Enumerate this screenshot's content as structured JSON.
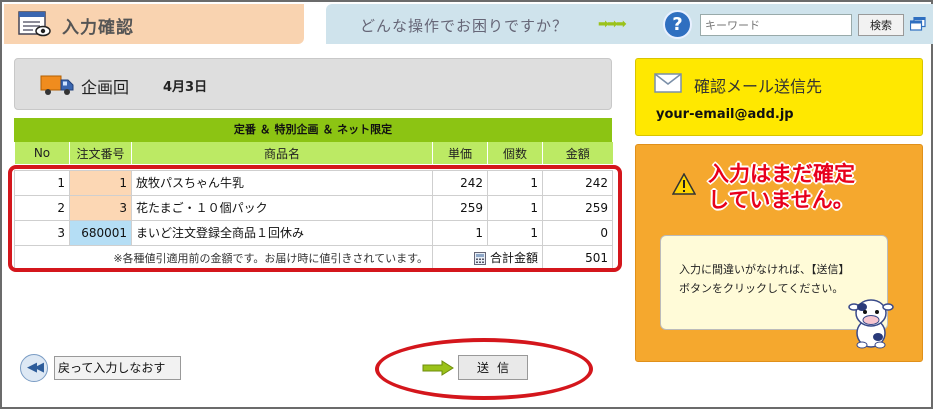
{
  "header": {
    "title": "入力確認",
    "question": "どんな操作でお困りですか？",
    "arrows": "➡➡➡",
    "help_label": "?",
    "search_placeholder": "キーワード",
    "search_button": "検索"
  },
  "plan": {
    "label": "企画回",
    "date": "4月3日"
  },
  "order": {
    "caption": "定番 ＆ 特別企画 ＆ ネット限定",
    "columns": [
      "No",
      "注文番号",
      "商品名",
      "単価",
      "個数",
      "金額"
    ],
    "rows": [
      {
        "no": "1",
        "order_no": "1",
        "name": "放牧パスちゃん牛乳",
        "price": "242",
        "qty": "1",
        "amount": "242"
      },
      {
        "no": "2",
        "order_no": "3",
        "name": "花たまご・１０個パック",
        "price": "259",
        "qty": "1",
        "amount": "259"
      },
      {
        "no": "3",
        "order_no": "680001",
        "name": "まいど注文登録全商品１回休み",
        "price": "1",
        "qty": "1",
        "amount": "0"
      }
    ],
    "note": "※各種値引適用前の金額です。お届け時に値引きされています。",
    "total_label": "合計金額",
    "total": "501"
  },
  "mail": {
    "title": "確認メール送信先",
    "address": "your-email@add.jp"
  },
  "warning": {
    "line1": "入力はまだ確定",
    "line2": "していません。",
    "message_line1": "入力に間違いがなければ、【送信】",
    "message_line2": "ボタンをクリックしてください。"
  },
  "actions": {
    "back_label": "戻って入力しなおす",
    "send_label": "送信"
  },
  "colors": {
    "accent_green": "#8cc413",
    "header_green": "#bcea64",
    "highlight_red": "#d4161c",
    "mail_yellow": "#ffe800",
    "warn_orange": "#f5a82e"
  }
}
